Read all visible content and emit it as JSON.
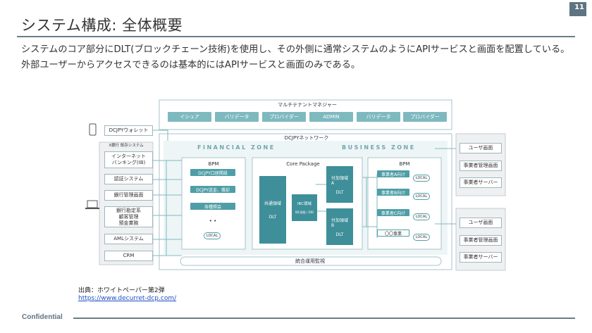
{
  "slide": {
    "title": "システム構成: 全体概要",
    "page_number": "11",
    "description": "システムのコア部分にDLT(ブロックチェーン技術)を使用し、その外側に通常システムのようにAPIサービスと画面を配置している。外部ユーザーからアクセスできるのは基本的にはAPIサービスと画面のみである。",
    "footer": "Confidential",
    "source_label": "出典：ホワイトペーパー第2弾",
    "source_url": "https://www.decurret-dcp.com/"
  },
  "diagram": {
    "manager": {
      "title": "マルチテナントマネジャー",
      "items": [
        "イシュア",
        "バリデータ",
        "プロバイダー",
        "ADMIN",
        "バリデータ",
        "プロバイダー"
      ]
    },
    "wallet": "DCJPYウォレット",
    "bank_group_title": "X銀行 既存システム",
    "bank_systems": [
      "インターネット\nバンキング(IB)",
      "認証システム",
      "銀行管理画面",
      "銀行勘定系\n顧客管理\n預金業務",
      "AMLシステム",
      "CRM"
    ],
    "network_title": "DCJPYネットワーク",
    "financial_zone": {
      "title": "FINANCIAL ZONE",
      "bpm": "BPM",
      "buttons": [
        "DCJPY口座開設",
        "DCJPY送金、償却",
        "各種照会"
      ],
      "local": "LOCAL"
    },
    "core": {
      "title": "Core Package",
      "common": "共通領域",
      "dlt": "DLT",
      "ibc": "IBC領域",
      "ibc_sub": "IBC前段 / DID",
      "addon_a": "付加領域\nA",
      "addon_b": "付加領域\nB"
    },
    "business_zone": {
      "title": "BUSINESS ZONE",
      "bpm": "BPM",
      "items": [
        "事業者A向け",
        "事業者B向け",
        "事業者C向け",
        "〇〇事業"
      ],
      "local": "LOCAL"
    },
    "bottom_bar": "統合運用監視",
    "right_top": [
      "ユーザ画面",
      "事業者管理画面",
      "事業者サーバー"
    ],
    "right_bottom": [
      "ユーザ画面",
      "事業者管理画面",
      "事業者サーバー"
    ]
  }
}
